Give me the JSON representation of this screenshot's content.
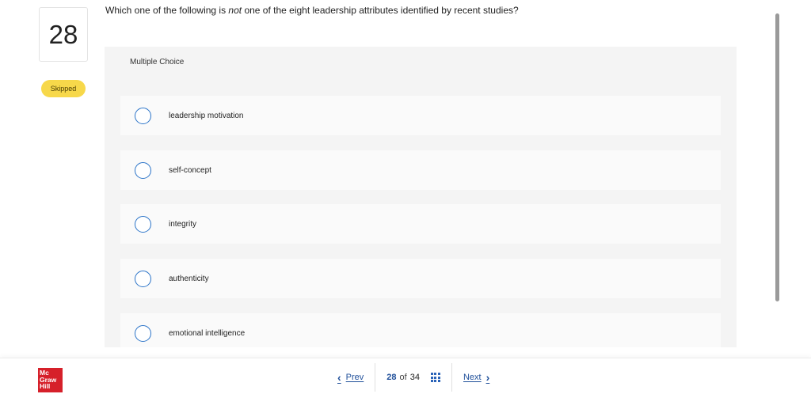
{
  "question": {
    "number": "28",
    "status": "Skipped",
    "text_before": "Which one of the following is ",
    "text_emph": "not",
    "text_after": " one of the eight leadership attributes identified by recent studies?",
    "type_label": "Multiple Choice"
  },
  "options": [
    {
      "label": "leadership motivation"
    },
    {
      "label": "self-concept"
    },
    {
      "label": "integrity"
    },
    {
      "label": "authenticity"
    },
    {
      "label": "emotional intelligence"
    }
  ],
  "footer": {
    "logo_lines": [
      "Mc",
      "Graw",
      "Hill"
    ],
    "prev_label": "Prev",
    "next_label": "Next",
    "current_page": "28",
    "of_label": "of",
    "total_pages": "34"
  },
  "icons": {
    "prev": "chevron-left-icon",
    "next": "chevron-right-icon",
    "grid": "grid-icon",
    "radio": "radio-empty-icon"
  },
  "colors": {
    "badge": "#f7d84a",
    "radio_border": "#2a73c8",
    "link": "#1f4f9a",
    "logo": "#d6202a",
    "panel": "#f4f4f4"
  }
}
